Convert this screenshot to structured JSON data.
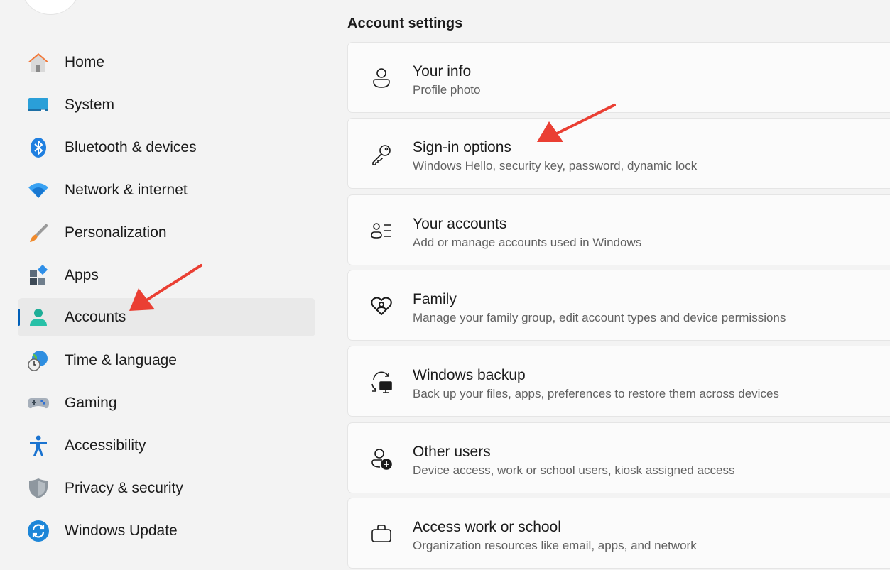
{
  "sidebar": {
    "items": [
      {
        "label": "Home",
        "icon": "home-icon"
      },
      {
        "label": "System",
        "icon": "system-icon"
      },
      {
        "label": "Bluetooth & devices",
        "icon": "bluetooth-icon"
      },
      {
        "label": "Network & internet",
        "icon": "wifi-icon"
      },
      {
        "label": "Personalization",
        "icon": "brush-icon"
      },
      {
        "label": "Apps",
        "icon": "apps-icon"
      },
      {
        "label": "Accounts",
        "icon": "accounts-icon",
        "selected": true
      },
      {
        "label": "Time & language",
        "icon": "globe-clock-icon"
      },
      {
        "label": "Gaming",
        "icon": "gamepad-icon"
      },
      {
        "label": "Accessibility",
        "icon": "accessibility-icon"
      },
      {
        "label": "Privacy & security",
        "icon": "shield-icon"
      },
      {
        "label": "Windows Update",
        "icon": "update-icon"
      }
    ]
  },
  "main": {
    "section_title": "Account settings",
    "cards": [
      {
        "title": "Your info",
        "subtitle": "Profile photo",
        "icon": "person-icon"
      },
      {
        "title": "Sign-in options",
        "subtitle": "Windows Hello, security key, password, dynamic lock",
        "icon": "key-icon"
      },
      {
        "title": "Your accounts",
        "subtitle": "Add or manage accounts used in Windows",
        "icon": "person-list-icon"
      },
      {
        "title": "Family",
        "subtitle": "Manage your family group, edit account types and device permissions",
        "icon": "family-heart-icon"
      },
      {
        "title": "Windows backup",
        "subtitle": "Back up your files, apps, preferences to restore them across devices",
        "icon": "backup-icon"
      },
      {
        "title": "Other users",
        "subtitle": "Device access, work or school users, kiosk assigned access",
        "icon": "person-add-icon"
      },
      {
        "title": "Access work or school",
        "subtitle": "Organization resources like email, apps, and network",
        "icon": "briefcase-icon"
      }
    ]
  },
  "colors": {
    "accent": "#005fb8",
    "annotation_arrow": "#ea3f33",
    "background": "#f3f3f3",
    "card": "#fbfbfb"
  }
}
